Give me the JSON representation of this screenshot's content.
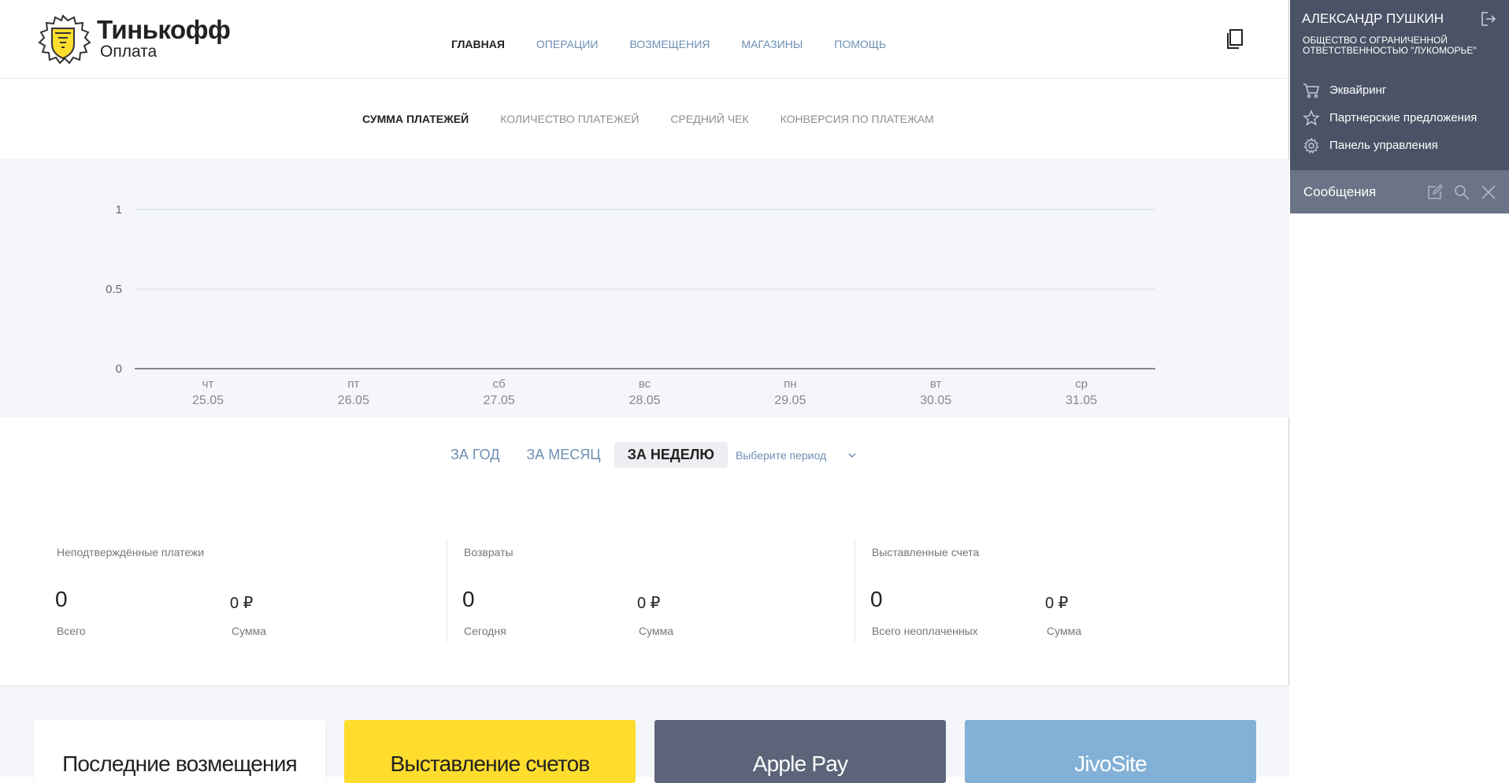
{
  "brand": {
    "name": "Тинькофф",
    "sub": "Оплата"
  },
  "nav": {
    "items": [
      {
        "label": "ГЛАВНАЯ"
      },
      {
        "label": "ОПЕРАЦИИ"
      },
      {
        "label": "ВОЗМЕЩЕНИЯ"
      },
      {
        "label": "МАГАЗИНЫ"
      },
      {
        "label": "ПОМОЩЬ"
      }
    ],
    "active_index": 0
  },
  "metric_tabs": [
    {
      "label": "СУММА ПЛАТЕЖЕЙ"
    },
    {
      "label": "КОЛИЧЕСТВО ПЛАТЕЖЕЙ"
    },
    {
      "label": "СРЕДНИЙ ЧЕК"
    },
    {
      "label": "КОНВЕРСИЯ ПО ПЛАТЕЖАМ"
    }
  ],
  "chart_data": {
    "type": "line",
    "x_days": [
      "чт",
      "пт",
      "сб",
      "вс",
      "пн",
      "вт",
      "ср"
    ],
    "x_dates": [
      "25.05",
      "26.05",
      "27.05",
      "28.05",
      "29.05",
      "30.05",
      "31.05"
    ],
    "y_ticks": [
      "0",
      "0.5",
      "1"
    ],
    "ylim": [
      0,
      1
    ],
    "series": [
      {
        "values": [
          0,
          0,
          0,
          0,
          0,
          0,
          0
        ]
      }
    ],
    "grid": true
  },
  "period": {
    "buttons": [
      {
        "label": "ЗА ГОД"
      },
      {
        "label": "ЗА МЕСЯЦ"
      },
      {
        "label": "ЗА НЕДЕЛЮ"
      }
    ],
    "active_index": 2,
    "select_placeholder": "Выберите период"
  },
  "stats": [
    {
      "title": "Неподтверждённые платежи",
      "count": "0",
      "count_label": "Всего",
      "sum": "0 ₽",
      "sum_label": "Сумма"
    },
    {
      "title": "Возвраты",
      "count": "0",
      "count_label": "Сегодня",
      "sum": "0 ₽",
      "sum_label": "Сумма"
    },
    {
      "title": "Выставленные счета",
      "count": "0",
      "count_label": "Всего неоплаченных",
      "sum": "0 ₽",
      "sum_label": "Сумма"
    }
  ],
  "cards": [
    {
      "label": "Последние возмещения"
    },
    {
      "label": "Выставление счетов"
    },
    {
      "label": "Apple Pay"
    },
    {
      "label": "JivoSite"
    }
  ],
  "panel": {
    "user_name": "АЛЕКСАНДР ПУШКИН",
    "company": "ОБЩЕСТВО С ОГРАНИЧЕННОЙ ОТВЕТСТВЕННОСТЬЮ \"ЛУКОМОРЬЕ\"",
    "menu": [
      {
        "label": "Эквайринг",
        "icon": "cart-icon"
      },
      {
        "label": "Партнерские предложения",
        "icon": "star-icon"
      },
      {
        "label": "Панель управления",
        "icon": "gear-icon"
      }
    ],
    "messages_title": "Сообщения"
  },
  "colors": {
    "accent_yellow": "#ffdd2d",
    "link_blue": "#6c8fb4",
    "panel_dark": "#4a5365",
    "panel_bar": "#6b7486",
    "card_dark": "#5b6478",
    "card_blue": "#82b0d6",
    "chart_bg": "#f4f6f9"
  }
}
